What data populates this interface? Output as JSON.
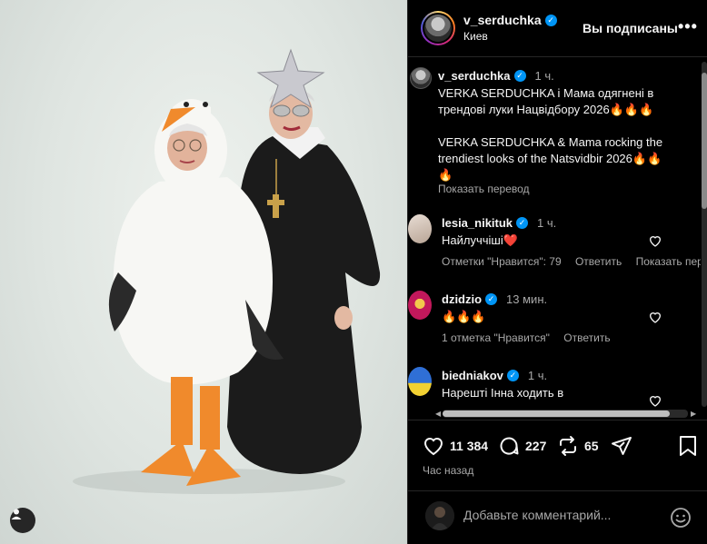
{
  "header": {
    "username": "v_serduchka",
    "location": "Киев",
    "follow_label": "Вы подписаны",
    "more_label": "•••"
  },
  "caption": {
    "username": "v_serduchka",
    "time": "1 ч.",
    "text": "VERKA SERDUCHKA і Мама одягнені в трендові луки Нацвідбору 2026🔥🔥🔥\n\nVERKA SERDUCHKA & Mama rocking the trendiest looks of the Natsvidbir 2026🔥🔥🔥",
    "translate_label": "Показать перевод"
  },
  "comments": [
    {
      "username": "lesia_nikituk",
      "time": "1 ч.",
      "text": "Найлуччіші❤️",
      "likes_label": "Отметки \"Нравится\": 79",
      "reply_label": "Ответить",
      "translate_label": "Показать перевод"
    },
    {
      "username": "dzidzio",
      "time": "13 мин.",
      "text": "🔥🔥🔥",
      "likes_label": "1 отметка \"Нравится\"",
      "reply_label": "Ответить"
    },
    {
      "username": "biedniakov",
      "time": "1 ч.",
      "text": "Нарешті Інна ходить в"
    }
  ],
  "actions": {
    "likes": "11 384",
    "comments": "227",
    "reposts": "65",
    "posted": "Час назад"
  },
  "composer": {
    "placeholder": "Добавьте комментарий..."
  },
  "icons": {
    "like": "heart-icon",
    "comment": "comment-bubble-icon",
    "repost": "repost-icon",
    "share": "paper-plane-icon",
    "save": "bookmark-icon",
    "emoji": "smiley-icon",
    "tags": "user-tag-icon"
  },
  "colors": {
    "verified": "#0095f6",
    "background": "#000000",
    "secondary_text": "#a8a8a8"
  }
}
